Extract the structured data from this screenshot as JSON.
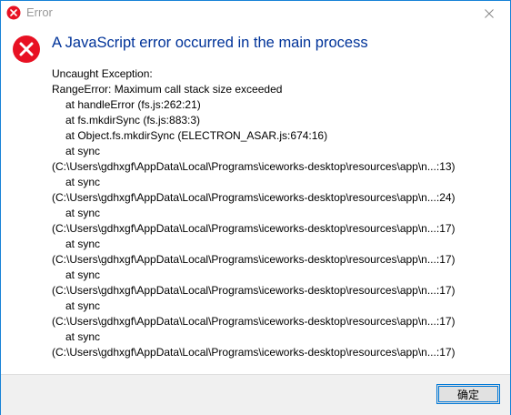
{
  "window": {
    "title": "Error",
    "icon": "error-icon",
    "close_icon": "close-icon"
  },
  "dialog": {
    "heading": "A JavaScript error occurred in the main process",
    "lines": [
      {
        "text": "Uncaught Exception:",
        "indent": false
      },
      {
        "text": "RangeError: Maximum call stack size exceeded",
        "indent": false
      },
      {
        "text": "at handleError (fs.js:262:21)",
        "indent": true
      },
      {
        "text": "at fs.mkdirSync (fs.js:883:3)",
        "indent": true
      },
      {
        "text": "at Object.fs.mkdirSync (ELECTRON_ASAR.js:674:16)",
        "indent": true
      },
      {
        "text": "at sync",
        "indent": true
      },
      {
        "text": "(C:\\Users\\gdhxgf\\AppData\\Local\\Programs\\iceworks-desktop\\resources\\app\\n...:13)",
        "indent": false
      },
      {
        "text": "at sync",
        "indent": true
      },
      {
        "text": "(C:\\Users\\gdhxgf\\AppData\\Local\\Programs\\iceworks-desktop\\resources\\app\\n...:24)",
        "indent": false
      },
      {
        "text": "at sync",
        "indent": true
      },
      {
        "text": "(C:\\Users\\gdhxgf\\AppData\\Local\\Programs\\iceworks-desktop\\resources\\app\\n...:17)",
        "indent": false
      },
      {
        "text": "at sync",
        "indent": true
      },
      {
        "text": "(C:\\Users\\gdhxgf\\AppData\\Local\\Programs\\iceworks-desktop\\resources\\app\\n...:17)",
        "indent": false
      },
      {
        "text": "at sync",
        "indent": true
      },
      {
        "text": "(C:\\Users\\gdhxgf\\AppData\\Local\\Programs\\iceworks-desktop\\resources\\app\\n...:17)",
        "indent": false
      },
      {
        "text": "at sync",
        "indent": true
      },
      {
        "text": "(C:\\Users\\gdhxgf\\AppData\\Local\\Programs\\iceworks-desktop\\resources\\app\\n...:17)",
        "indent": false
      },
      {
        "text": "at sync",
        "indent": true
      },
      {
        "text": "(C:\\Users\\gdhxgf\\AppData\\Local\\Programs\\iceworks-desktop\\resources\\app\\n...:17)",
        "indent": false
      }
    ]
  },
  "footer": {
    "ok_label": "确定"
  },
  "colors": {
    "heading": "#003399",
    "error_red": "#e81123",
    "accent": "#0078d7"
  }
}
